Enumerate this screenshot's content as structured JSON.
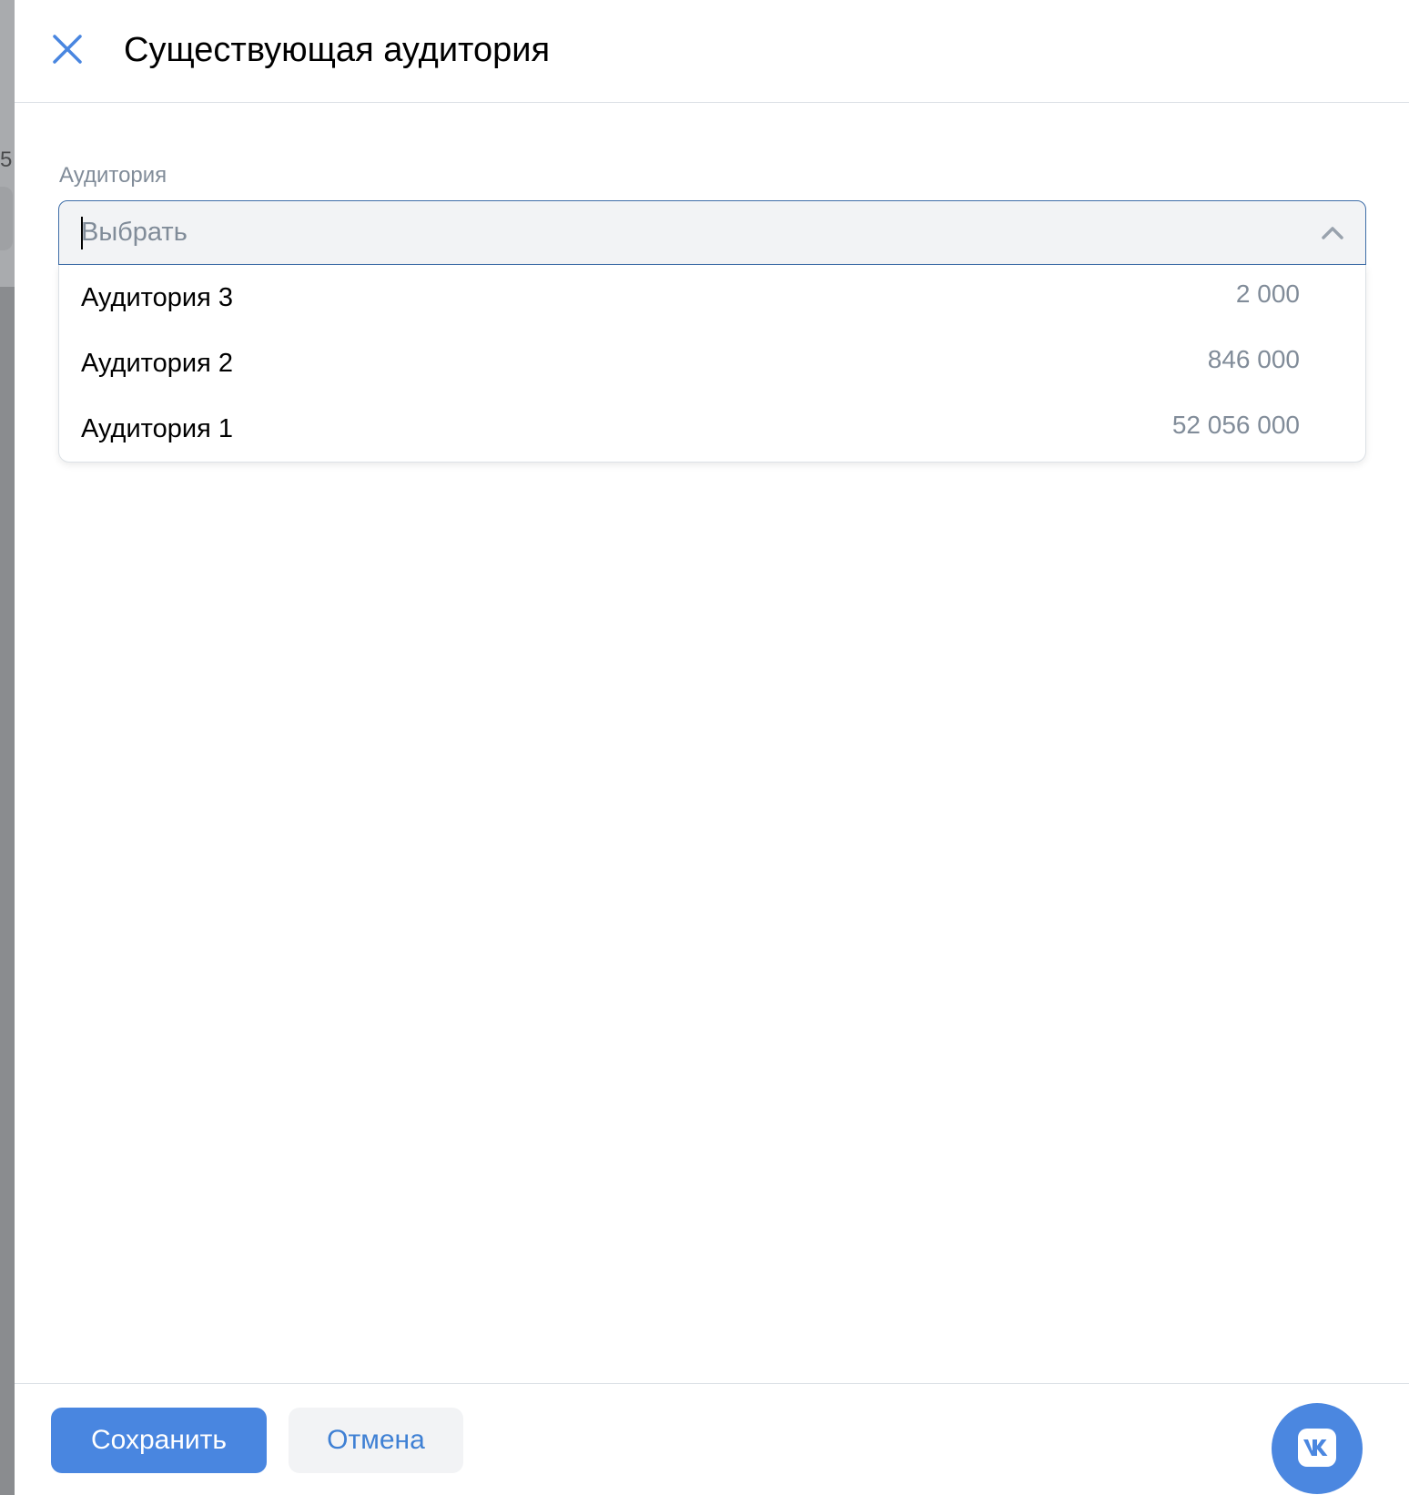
{
  "backdrop": {
    "partial_digit": "5"
  },
  "header": {
    "close_icon": "close-icon",
    "title": "Существующая аудитория"
  },
  "form": {
    "audience_label": "Аудитория",
    "select": {
      "placeholder": "Выбрать",
      "chevron_icon": "chevron-up-icon",
      "expanded": true
    },
    "options": [
      {
        "label": "Аудитория 3",
        "count": "2 000"
      },
      {
        "label": "Аудитория 2",
        "count": "846 000"
      },
      {
        "label": "Аудитория 1",
        "count": "52 056 000"
      }
    ]
  },
  "footer": {
    "save_label": "Сохранить",
    "cancel_label": "Отмена",
    "vk_icon": "vk-logo-icon"
  },
  "colors": {
    "accent": "#4986e0",
    "link": "#3f80d4",
    "muted_text": "#818c99",
    "input_bg": "#f2f3f5",
    "focus_border": "#3f6ea8"
  }
}
